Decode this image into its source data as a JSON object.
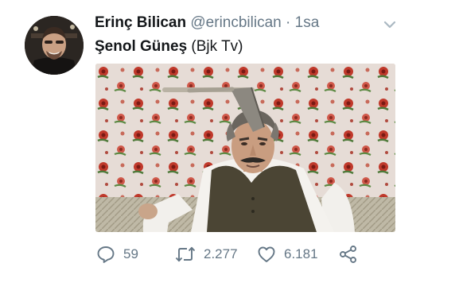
{
  "tweet": {
    "author_name": "Erinç Bilican",
    "author_handle": "@erincbilican",
    "separator": "·",
    "time": "1sa",
    "text_bold": "Şenol Güneş",
    "text_rest": " (Bjk Tv)",
    "replies": "59",
    "retweets": "2.277",
    "likes": "6.181"
  },
  "colors": {
    "text": "#14171a",
    "muted": "#657786"
  }
}
